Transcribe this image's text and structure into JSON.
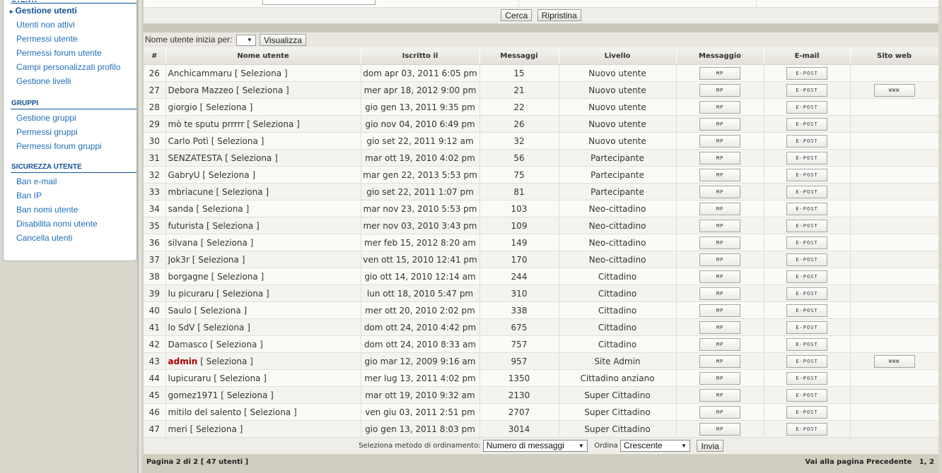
{
  "sidebar": {
    "sections": [
      {
        "title": "UTENTI",
        "items": [
          {
            "label": "Gestione utenti",
            "active": true
          },
          {
            "label": "Utenti non attivi"
          },
          {
            "label": "Permessi utente"
          },
          {
            "label": "Permessi forum utente"
          },
          {
            "label": "Campi personalizzati profilo"
          },
          {
            "label": "Gestione livelli"
          }
        ]
      },
      {
        "title": "GRUPPI",
        "items": [
          {
            "label": "Gestione gruppi"
          },
          {
            "label": "Permessi gruppi"
          },
          {
            "label": "Permessi forum gruppi"
          }
        ]
      },
      {
        "title": "SICUREZZA UTENTE",
        "items": [
          {
            "label": "Ban e-mail"
          },
          {
            "label": "Ban IP"
          },
          {
            "label": "Ban nomi utente"
          },
          {
            "label": "Disabilita nomi utente"
          },
          {
            "label": "Cancella utenti"
          }
        ]
      }
    ]
  },
  "filter": {
    "search_label": "Cerca",
    "reset_label": "Ripristina",
    "initial_label": "Nome utente inizia per:",
    "initial_value": "",
    "show_label": "Visualizza"
  },
  "table": {
    "headers": [
      "#",
      "Nome utente",
      "Iscritto il",
      "Messaggi",
      "Livello",
      "Messaggio",
      "E-mail",
      "Sito web"
    ],
    "select_text": "[ Seleziona ]",
    "pm_label": "MP",
    "email_label": "E-POST",
    "www_label": "WWW",
    "rows": [
      {
        "n": "26",
        "name": "Anchicammaru",
        "date": "dom apr 03, 2011 6:05 pm",
        "posts": "15",
        "rank": "Nuovo utente",
        "www": false
      },
      {
        "n": "27",
        "name": "Debora Mazzeo",
        "date": "mer apr 18, 2012 9:00 pm",
        "posts": "21",
        "rank": "Nuovo utente",
        "www": true
      },
      {
        "n": "28",
        "name": "giorgio",
        "date": "gio gen 13, 2011 9:35 pm",
        "posts": "22",
        "rank": "Nuovo utente",
        "www": false
      },
      {
        "n": "29",
        "name": "mò te sputu prrrrr",
        "date": "gio nov 04, 2010 6:49 pm",
        "posts": "26",
        "rank": "Nuovo utente",
        "www": false
      },
      {
        "n": "30",
        "name": "Carlo Potì",
        "date": "gio set 22, 2011 9:12 am",
        "posts": "32",
        "rank": "Nuovo utente",
        "www": false
      },
      {
        "n": "31",
        "name": "SENZATESTA",
        "date": "mar ott 19, 2010 4:02 pm",
        "posts": "56",
        "rank": "Partecipante",
        "www": false
      },
      {
        "n": "32",
        "name": "GabryU",
        "date": "mar gen 22, 2013 5:53 pm",
        "posts": "75",
        "rank": "Partecipante",
        "www": false
      },
      {
        "n": "33",
        "name": "mbriacune",
        "date": "gio set 22, 2011 1:07 pm",
        "posts": "81",
        "rank": "Partecipante",
        "www": false
      },
      {
        "n": "34",
        "name": "sanda",
        "date": "mar nov 23, 2010 5:53 pm",
        "posts": "103",
        "rank": "Neo-cittadino",
        "www": false
      },
      {
        "n": "35",
        "name": "futurista",
        "date": "mer nov 03, 2010 3:43 pm",
        "posts": "109",
        "rank": "Neo-cittadino",
        "www": false
      },
      {
        "n": "36",
        "name": "silvana",
        "date": "mer feb 15, 2012 8:20 am",
        "posts": "149",
        "rank": "Neo-cittadino",
        "www": false
      },
      {
        "n": "37",
        "name": "Jok3r",
        "date": "ven ott 15, 2010 12:41 pm",
        "posts": "170",
        "rank": "Neo-cittadino",
        "www": false
      },
      {
        "n": "38",
        "name": "borgagne",
        "date": "gio ott 14, 2010 12:14 am",
        "posts": "244",
        "rank": "Cittadino",
        "www": false
      },
      {
        "n": "39",
        "name": "lu picuraru",
        "date": "lun ott 18, 2010 5:47 pm",
        "posts": "310",
        "rank": "Cittadino",
        "www": false
      },
      {
        "n": "40",
        "name": "Saulo",
        "date": "mer ott 20, 2010 2:02 pm",
        "posts": "338",
        "rank": "Cittadino",
        "www": false
      },
      {
        "n": "41",
        "name": "lo SdV",
        "date": "dom ott 24, 2010 4:42 pm",
        "posts": "675",
        "rank": "Cittadino",
        "www": false
      },
      {
        "n": "42",
        "name": "Damasco",
        "date": "dom ott 24, 2010 8:33 am",
        "posts": "757",
        "rank": "Cittadino",
        "www": false
      },
      {
        "n": "43",
        "name": "admin",
        "date": "gio mar 12, 2009 9:16 am",
        "posts": "957",
        "rank": "Site Admin",
        "www": true,
        "admin": true
      },
      {
        "n": "44",
        "name": "lupicuraru",
        "date": "mer lug 13, 2011 4:02 pm",
        "posts": "1350",
        "rank": "Cittadino anziano",
        "www": false
      },
      {
        "n": "45",
        "name": "gomez1971",
        "date": "mar ott 19, 2010 9:32 am",
        "posts": "2130",
        "rank": "Super Cittadino",
        "www": false
      },
      {
        "n": "46",
        "name": "mitilo del salento",
        "date": "ven giu 03, 2011 2:51 pm",
        "posts": "2707",
        "rank": "Super Cittadino",
        "www": false
      },
      {
        "n": "47",
        "name": "meri",
        "date": "gio gen 13, 2011 8:03 pm",
        "posts": "3014",
        "rank": "Super Cittadino",
        "www": false
      }
    ]
  },
  "sort": {
    "method_label": "Seleziona metodo di ordinamento:",
    "method_value": "Numero di messaggi",
    "order_label": "Ordina",
    "order_value": "Crescente",
    "submit_label": "Invia"
  },
  "footer": {
    "page_info": "Pagina 2 di 2 [ 47 utenti ]",
    "goto_label": "Vai alla pagina",
    "prev_label": "Precedente",
    "page1": "1",
    "page_sep": ",",
    "page2": "2"
  },
  "colors": {
    "link": "#1e6eb7",
    "admin": "#aa0000",
    "footer_bg": "#d1cebf"
  }
}
